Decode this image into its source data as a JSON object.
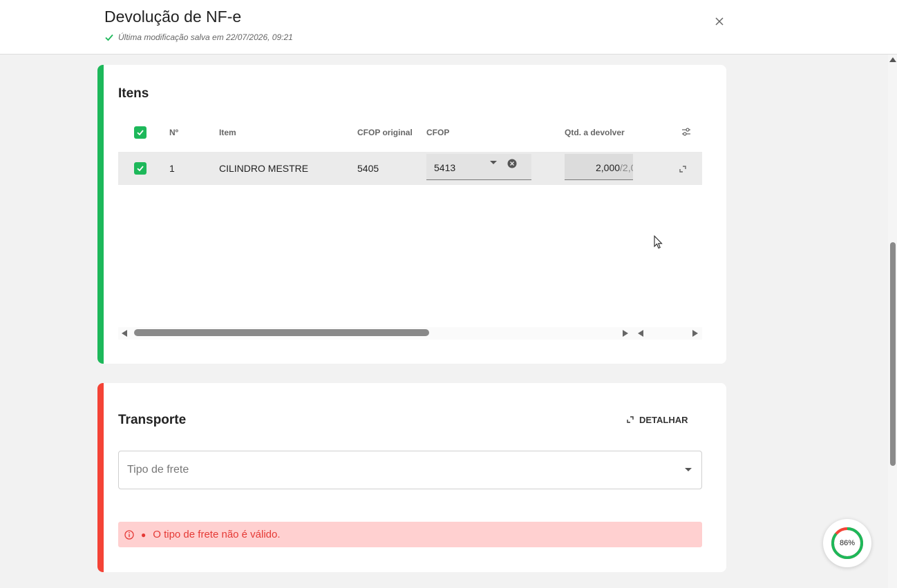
{
  "header": {
    "title": "Devolução de NF-e",
    "saved_text": "Última modificação salva em 22/07/2026, 09:21"
  },
  "items_section": {
    "title": "Itens",
    "columns": [
      "Nº",
      "Item",
      "CFOP original",
      "CFOP",
      "Qtd. a devolver"
    ],
    "rows": [
      {
        "number": "1",
        "item": "CILINDRO MESTRE",
        "cfop_original": "5405",
        "cfop": "5413",
        "qty": "2,000",
        "qty_total": "/2,0"
      }
    ]
  },
  "transport_section": {
    "title": "Transporte",
    "detail_button": "DETALHAR",
    "freight_placeholder": "Tipo de frete",
    "error_message": "O tipo de frete não é válido."
  },
  "progress": {
    "label": "86%",
    "value": 0.86
  },
  "colors": {
    "accent_green": "#1db85a",
    "error_red": "#f44336",
    "error_bg": "#ffd0d0"
  }
}
